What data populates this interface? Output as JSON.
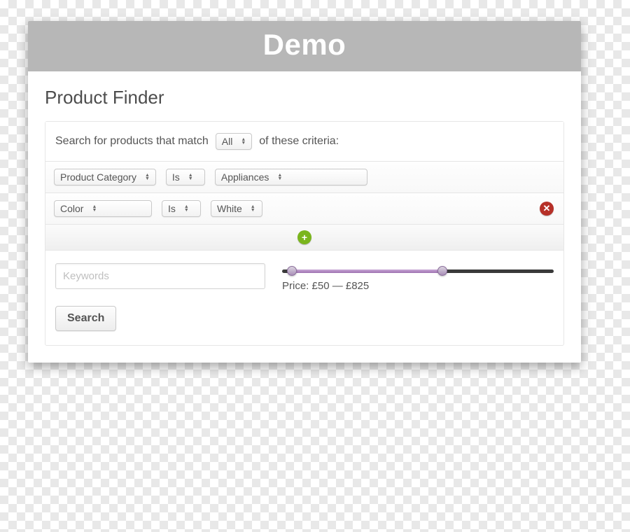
{
  "header": {
    "title": "Demo"
  },
  "page": {
    "title": "Product Finder"
  },
  "match": {
    "prefix": "Search for products that match",
    "selector_value": "All",
    "suffix": "of these criteria:"
  },
  "criteria": [
    {
      "field": "Product Category",
      "operator": "Is",
      "value": "Appliances"
    },
    {
      "field": "Color",
      "operator": "Is",
      "value": "White"
    }
  ],
  "keywords": {
    "placeholder": "Keywords",
    "value": ""
  },
  "price": {
    "label_prefix": "Price:",
    "currency": "£",
    "min": 50,
    "max": 825,
    "range_min": 0,
    "range_max": 1400
  },
  "buttons": {
    "search": "Search"
  },
  "icons": {
    "add": "+",
    "remove": "✕"
  }
}
